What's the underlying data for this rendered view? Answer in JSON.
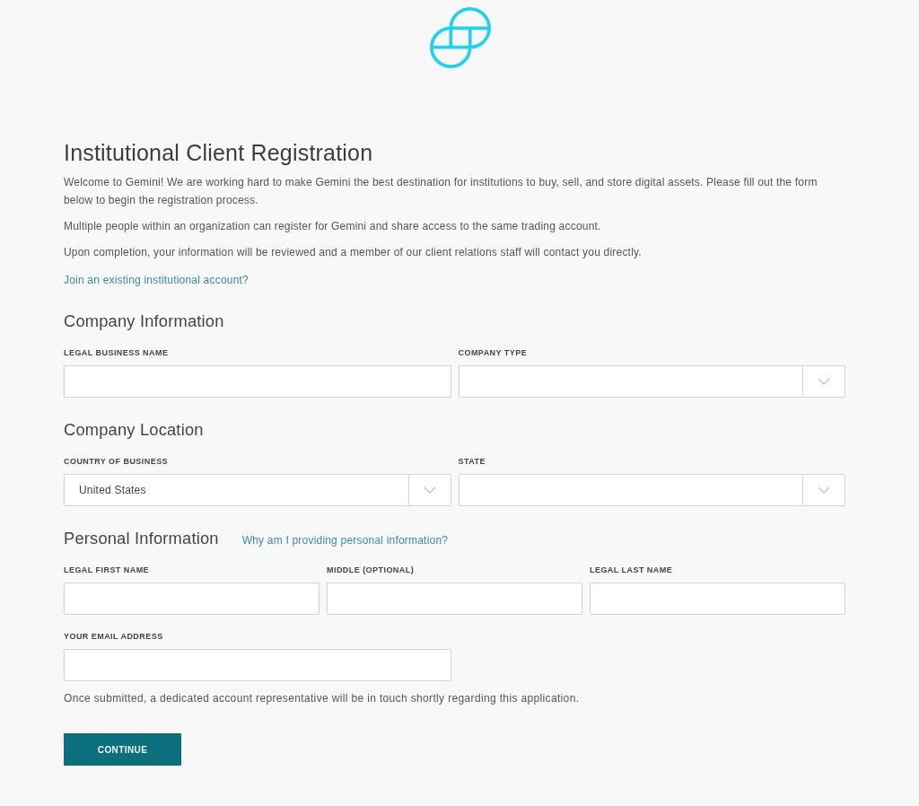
{
  "title": "Institutional Client Registration",
  "intro": [
    "Welcome to Gemini! We are working hard to make Gemini the best destination for institutions to buy, sell, and store digital assets. Please fill out the form below to begin the registration process.",
    "Multiple people within an organization can register for Gemini and share access to the same trading account.",
    "Upon completion, your information will be reviewed and a member of our client relations staff will contact you directly."
  ],
  "join_link": "Join an existing institutional account?",
  "sections": [
    {
      "heading": "Company Information",
      "rows": [
        [
          {
            "kind": "text",
            "label": "LEGAL BUSINESS NAME"
          },
          {
            "kind": "select",
            "label": "COMPANY TYPE"
          }
        ]
      ]
    },
    {
      "heading": "Company Location",
      "rows": [
        [
          {
            "kind": "select",
            "label": "COUNTRY OF BUSINESS",
            "value": "United States"
          },
          {
            "kind": "select",
            "label": "STATE"
          }
        ]
      ]
    },
    {
      "heading": "Personal Information",
      "help_link": "Why am I providing personal information?",
      "rows": [
        [
          {
            "kind": "text",
            "label": "LEGAL FIRST NAME"
          },
          {
            "kind": "text",
            "label": "MIDDLE (OPTIONAL)"
          },
          {
            "kind": "text",
            "label": "LEGAL LAST NAME"
          }
        ],
        [
          {
            "kind": "text",
            "label": "YOUR EMAIL ADDRESS"
          }
        ]
      ]
    }
  ],
  "note": "Once submitted, a dedicated account representative will be in touch shortly regarding this application.",
  "button": "CONTINUE"
}
